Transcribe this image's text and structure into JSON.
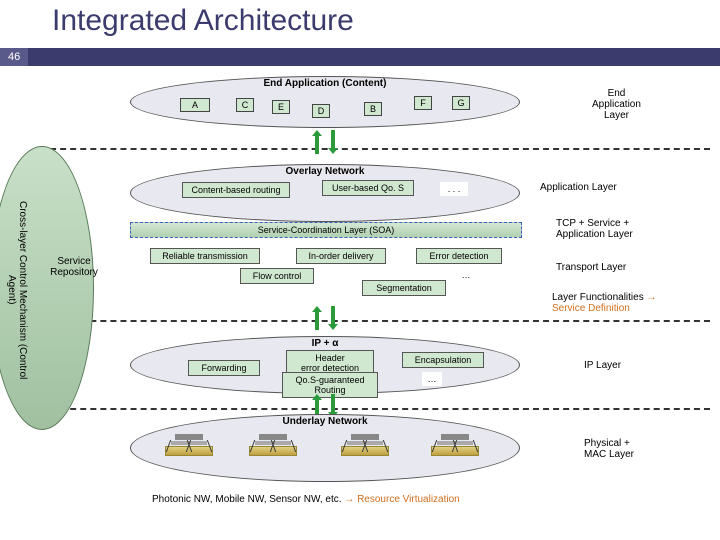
{
  "slide": {
    "title": "Integrated Architecture",
    "number": "46"
  },
  "app_layer": {
    "title": "End Application (Content)",
    "nodes": [
      "A",
      "C",
      "E",
      "D",
      "B",
      "F",
      "G"
    ],
    "right_label": "End\nApplication\nLayer"
  },
  "overlay": {
    "title": "Overlay Network",
    "boxes": {
      "cbr": "Content-based routing",
      "uqos": "User-based Qo. S",
      "dots": ". . ."
    },
    "right_label": "Application Layer"
  },
  "soa": {
    "label": "Service-Coordination Layer (SOA)",
    "right_label": "TCP + Service +\nApplication Layer"
  },
  "transport": {
    "boxes": {
      "rel": "Reliable transmission",
      "inorder": "In-order delivery",
      "err": "Error detection",
      "flow": "Flow control",
      "seg": "Segmentation",
      "dots": "…"
    },
    "right_label": "Transport Layer"
  },
  "func_label": {
    "a": "Layer Functionalities",
    "b": "Service Definition",
    "arrow": "→"
  },
  "ip": {
    "title": "IP + α",
    "boxes": {
      "fwd": "Forwarding",
      "hdr": "Header\nerror detection",
      "qos": "Qo.S-guaranteed\nRouting",
      "enc": "Encapsulation",
      "dots": "…"
    },
    "right_label": "IP Layer"
  },
  "underlay": {
    "title": "Underlay Network",
    "right_label": "Physical +\nMAC Layer",
    "caption_a": "Photonic NW, Mobile NW, Sensor NW, etc.",
    "caption_arrow": "→",
    "caption_b": "Resource Virtualization"
  },
  "left": {
    "service_repo": "Service\nRepository",
    "cross_layer": "Cross-layer Control Mechanism\n(Control Agent)"
  }
}
